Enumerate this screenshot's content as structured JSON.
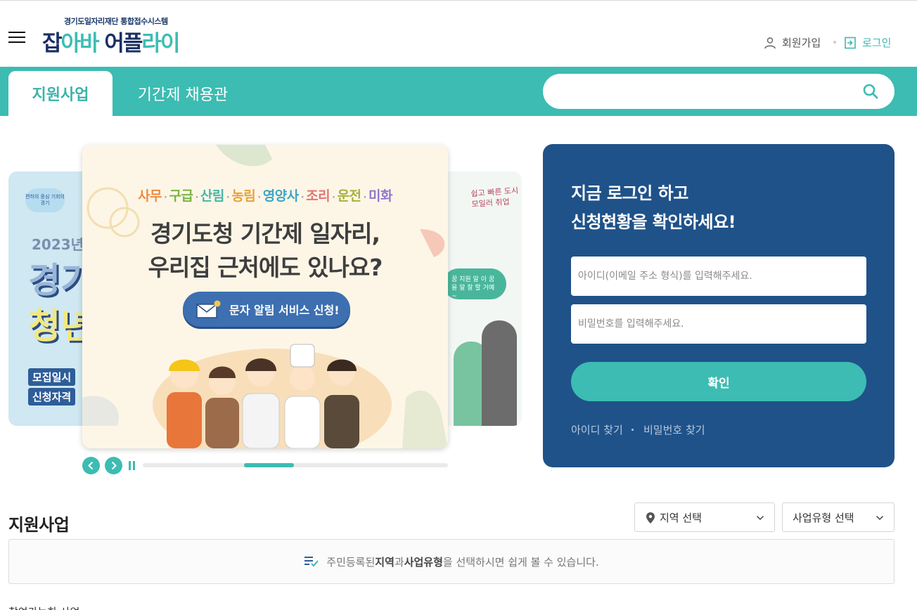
{
  "header": {
    "logo_sub": "경기도일자리재단 통합접수시스템",
    "logo_main_1": "잡",
    "logo_main_2": "아바",
    "logo_main_3": " 어플",
    "logo_main_4": "라이",
    "join_label": "회원가입",
    "login_label": "로그인"
  },
  "nav": {
    "tab_support": "지원사업",
    "tab_parttime": "기간제 채용관",
    "search_placeholder": ""
  },
  "banner": {
    "left": {
      "badge": "편하의 중심 기회의 경기",
      "year": "2023년",
      "big1": "경기",
      "big2": "청년",
      "pill1": "모집일시",
      "pill2": "신청자격"
    },
    "main": {
      "jobs": [
        "사무",
        "구급",
        "산림",
        "농림",
        "영양사",
        "조리",
        "운전",
        "미화"
      ],
      "job_colors": [
        "#f08a3e",
        "#7cb342",
        "#46b7a6",
        "#e8a23a",
        "#3aa6c7",
        "#e57373",
        "#a9b03c",
        "#9575cd"
      ],
      "headline_1": "경기도청 기간제 일자리,",
      "headline_2": "우리집 근처에도 있나요?",
      "sms_button": "문자 알림 서비스 신청!"
    },
    "right": {
      "hand_1": "쉽고 빠른 도시",
      "hand_2": "모일러 취업",
      "bubble": "꿈 지원 알 이 꿈을 알 잘 할 거예~"
    },
    "progress": 0.33
  },
  "login": {
    "title_1": "지금 로그인 하고",
    "title_2": "신청현황을 확인하세요!",
    "id_placeholder": "아이디(이메일 주소 형식)를 입력해주세요.",
    "pw_placeholder": "비밀번호를 입력해주세요.",
    "confirm": "확인",
    "find_id": "아이디 찾기",
    "find_pw": "비밀번호 찾기"
  },
  "section": {
    "title": "지원사업",
    "region_select": "지역 선택",
    "type_select": "사업유형 선택",
    "notice_pre": "주민등록된 ",
    "notice_b1": "지역",
    "notice_mid": "과 ",
    "notice_b2": "사업유형",
    "notice_post": "을 선택하시면 쉽게 볼 수 있습니다.",
    "bottom_peek": "참여가능한 사업"
  },
  "colors": {
    "teal": "#3cbcb2",
    "navy": "#1f5289",
    "logo_navy": "#1b2f63"
  }
}
